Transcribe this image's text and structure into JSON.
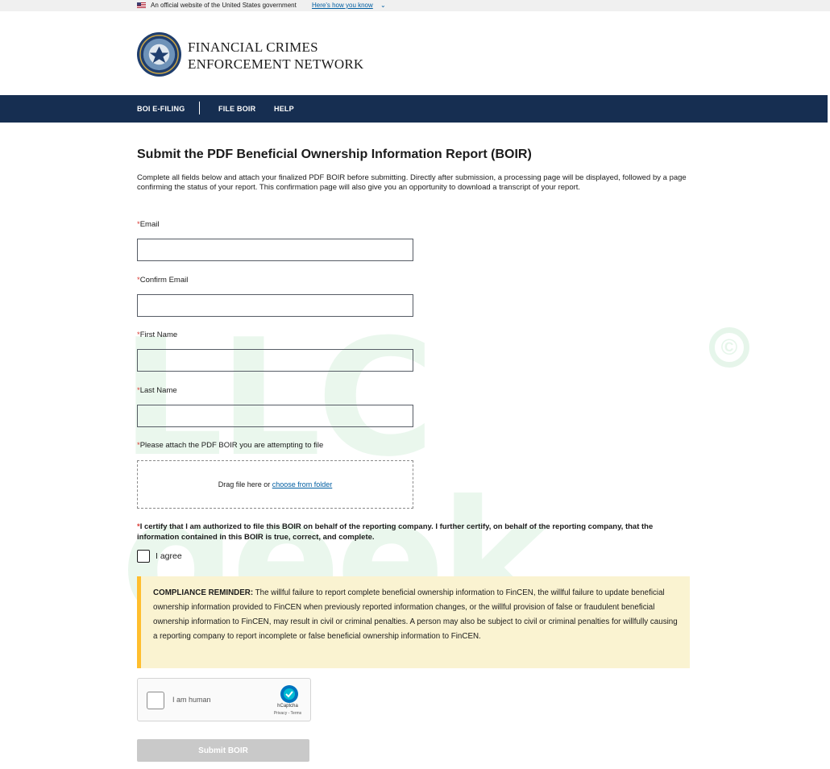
{
  "banner": {
    "official_text": "An official website of the United States government",
    "how_link": "Here's how you know",
    "flag_icon": "us-flag-icon"
  },
  "header": {
    "agency_line1": "FINANCIAL CRIMES",
    "agency_line2": "ENFORCEMENT NETWORK",
    "seal_icon": "fincen-seal-icon"
  },
  "nav": {
    "items": [
      {
        "label": "BOI E-FILING"
      },
      {
        "label": "FILE BOIR"
      },
      {
        "label": "HELP"
      }
    ]
  },
  "page": {
    "title": "Submit the PDF Beneficial Ownership Information Report (BOIR)",
    "intro": "Complete all fields below and attach your finalized PDF BOIR before submitting. Directly after submission, a processing page will be displayed, followed by a page confirming the status of your report. This confirmation page will also give you an opportunity to download a transcript of your report."
  },
  "form": {
    "required_mark": "*",
    "email": {
      "label": "Email",
      "value": "",
      "placeholder": ""
    },
    "confirm_email": {
      "label": "Confirm Email",
      "value": "",
      "placeholder": ""
    },
    "first_name": {
      "label": "First Name",
      "value": "",
      "placeholder": ""
    },
    "last_name": {
      "label": "Last Name",
      "value": "",
      "placeholder": ""
    },
    "attach": {
      "label": "Please attach the PDF BOIR you are attempting to file",
      "drag_text": "Drag file here or ",
      "choose_link": "choose from folder"
    },
    "certify_text": "I certify that I am authorized to file this BOIR on behalf of the reporting company. I further certify, on behalf of the reporting company, that the information contained in this BOIR is true, correct, and complete.",
    "agree_label": "I agree",
    "agree_checked": false
  },
  "alert": {
    "heading": "COMPLIANCE REMINDER:",
    "body": " The willful failure to report complete beneficial ownership information to FinCEN, the willful failure to update beneficial ownership information provided to FinCEN when previously reported information changes, or the willful provision of false or fraudulent beneficial ownership information to FinCEN, may result in civil or criminal penalties. A person may also be subject to civil or criminal penalties for willfully causing a reporting company to report incomplete or false beneficial ownership information to FinCEN.",
    "accent_color": "#ffbe2e",
    "background_color": "#faf3d1"
  },
  "captcha": {
    "label": "I am human",
    "brand": "hCaptcha",
    "links": "Privacy - Terms"
  },
  "submit": {
    "label": "Submit BOIR",
    "disabled": true
  },
  "watermark": {
    "text": "LLC geek",
    "symbol": "©"
  },
  "colors": {
    "nav_bg": "#162e51",
    "link": "#005ea2",
    "required": "#d83933"
  }
}
